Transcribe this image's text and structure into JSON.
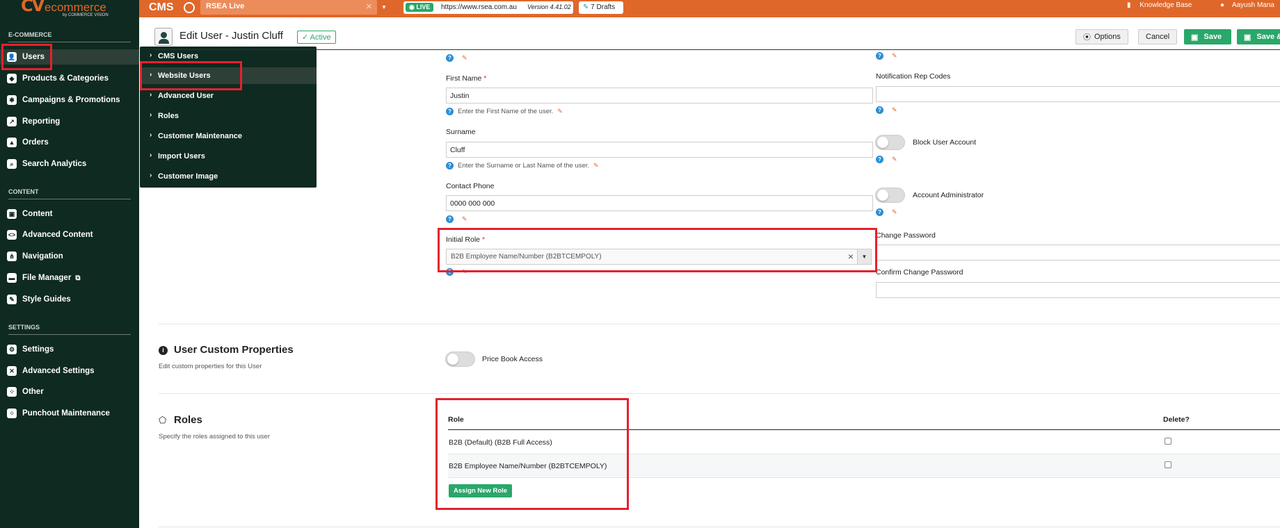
{
  "topbar": {
    "logo_cv": "CV",
    "logo_text": "ecommerce",
    "logo_by": "by COMMERCE VISION",
    "cms_label": "CMS",
    "site_name": "RSEA Live",
    "live_badge": "LIVE",
    "site_url": "https://www.rsea.com.au",
    "version": "Version 4.41.02",
    "drafts": "7 Drafts",
    "knowledge_base": "Knowledge Base",
    "user_name": "Aayush Mana"
  },
  "sidebar": {
    "sections": {
      "ecommerce": "E-COMMERCE",
      "content": "CONTENT",
      "settings": "SETTINGS"
    },
    "ecommerce_items": [
      {
        "label": "Users",
        "icon": "users-icon"
      },
      {
        "label": "Products & Categories",
        "icon": "tag-icon"
      },
      {
        "label": "Campaigns & Promotions",
        "icon": "megaphone-icon"
      },
      {
        "label": "Reporting",
        "icon": "chart-icon"
      },
      {
        "label": "Orders",
        "icon": "cart-icon"
      },
      {
        "label": "Search Analytics",
        "icon": "search-icon"
      }
    ],
    "content_items": [
      {
        "label": "Content",
        "icon": "content-icon"
      },
      {
        "label": "Advanced Content",
        "icon": "code-icon"
      },
      {
        "label": "Navigation",
        "icon": "sitemap-icon"
      },
      {
        "label": "File Manager",
        "icon": "folder-icon"
      },
      {
        "label": "Style Guides",
        "icon": "pen-icon"
      }
    ],
    "settings_items": [
      {
        "label": "Settings",
        "icon": "gear-icon"
      },
      {
        "label": "Advanced Settings",
        "icon": "tools-icon"
      },
      {
        "label": "Other",
        "icon": "grid-icon"
      },
      {
        "label": "Punchout Maintenance",
        "icon": "grid-icon"
      }
    ]
  },
  "flyout": {
    "items": [
      "CMS Users",
      "Website Users",
      "Advanced User",
      "Roles",
      "Customer Maintenance",
      "Import Users",
      "Customer Image"
    ]
  },
  "header": {
    "title": "Edit User - Justin Cluff",
    "status": "✓ Active",
    "options": "Options",
    "cancel": "Cancel",
    "save": "Save",
    "save_close": "Save &"
  },
  "form": {
    "first_name_label": "First Name",
    "first_name_value": "Justin",
    "first_name_help": "Enter the First Name of the user.",
    "surname_label": "Surname",
    "surname_value": "Cluff",
    "surname_help": "Enter the Surname or Last Name of the user.",
    "phone_label": "Contact Phone",
    "phone_value": "0000 000 000",
    "initial_role_label": "Initial Role",
    "initial_role_value": "B2B Employee Name/Number (B2BTCEMPOLY)",
    "required_mark": "*",
    "notification_label": "Notification Rep Codes",
    "notification_value": "",
    "block_label": "Block User Account",
    "admin_label": "Account Administrator",
    "change_pw_label": "Change Password",
    "confirm_pw_label": "Confirm Change Password"
  },
  "custom_props": {
    "title": "User Custom Properties",
    "desc": "Edit custom properties for this User",
    "price_book_label": "Price Book Access"
  },
  "roles": {
    "title": "Roles",
    "desc": "Specify the roles assigned to this user",
    "col_role": "Role",
    "col_delete": "Delete?",
    "rows": [
      "B2B (Default) (B2B Full Access)",
      "B2B Employee Name/Number (B2BTCEMPOLY)"
    ],
    "assign_button": "Assign New Role"
  },
  "colors": {
    "brand_orange": "#e0672a",
    "sidebar_green": "#0f2a20",
    "accent_green": "#2aa76a",
    "highlight_red": "#e5212e"
  }
}
